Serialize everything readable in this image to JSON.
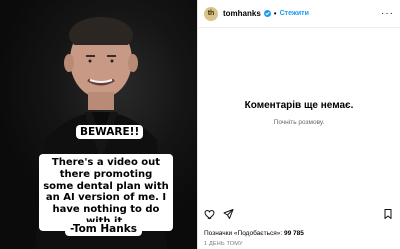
{
  "media": {
    "beware": "BEWARE!!",
    "message": "There's a video out there promoting some dental plan with an AI version of me. I have nothing to do with it.",
    "signature": "-Tom Hanks"
  },
  "header": {
    "avatar_text": "th",
    "username": "tomhanks",
    "follow_label": "Стежити",
    "more_label": "···"
  },
  "comments": {
    "empty_title": "Коментарів ще немає.",
    "empty_subtitle": "Почніть розмову."
  },
  "footer": {
    "likes_prefix": "Позначки «Подобається»:",
    "likes_count": "99 785",
    "time": "1 ДЕНЬ ТОМУ"
  },
  "colors": {
    "accent": "#1d9bf0"
  }
}
